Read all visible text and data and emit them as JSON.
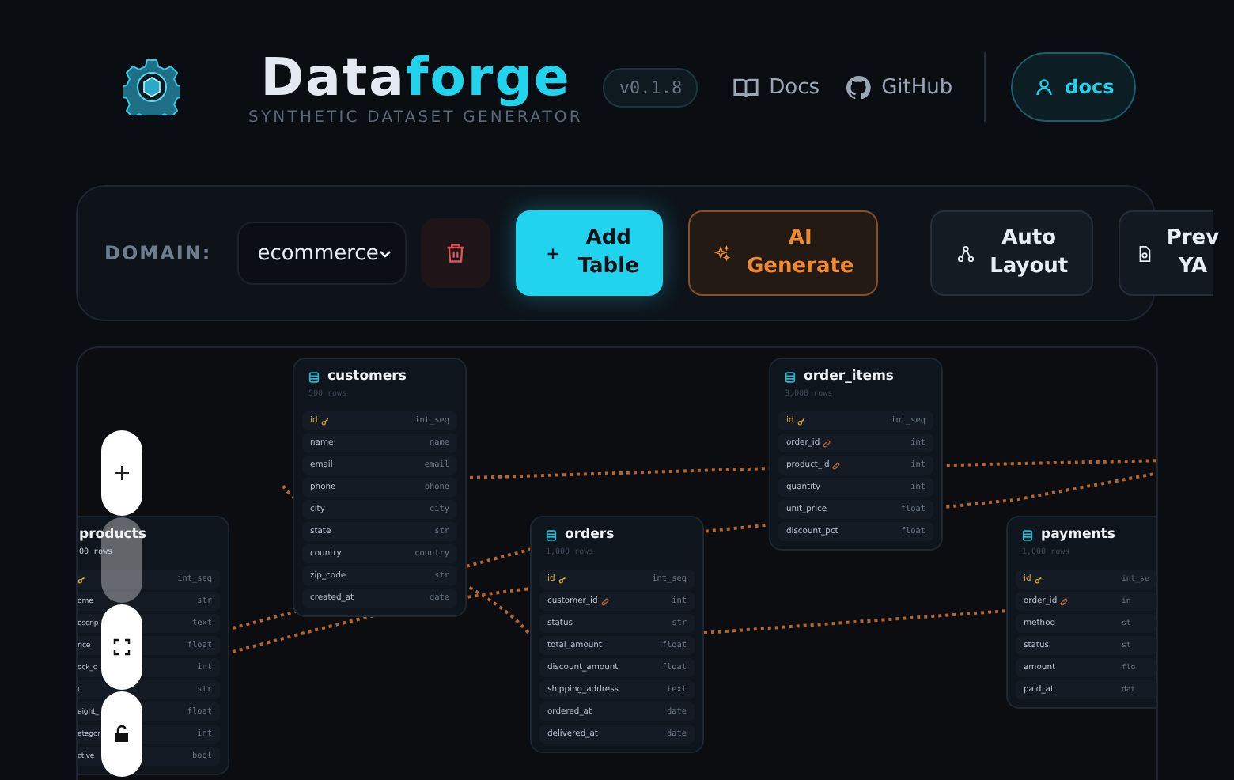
{
  "header": {
    "logo_text": [
      "Data",
      "forge"
    ],
    "subtitle": "SYNTHETIC DATASET GENERATOR",
    "version": "v0.1.8",
    "links": [
      {
        "kind": "book",
        "label": "Docs"
      },
      {
        "kind": "github",
        "label": "GitHub"
      }
    ],
    "user_button": {
      "label": "docs"
    }
  },
  "toolbar": {
    "domain_label": "DOMAIN:",
    "domain_value": "ecommerce",
    "buttons": [
      {
        "kind": "delete"
      },
      {
        "kind": "primary",
        "label": "Add Table"
      },
      {
        "kind": "accent",
        "label": "AI Generate"
      },
      {
        "kind": "secondary",
        "label": "Auto Layout"
      },
      {
        "kind": "cut",
        "label": "Prev YA"
      }
    ]
  },
  "canvas": {
    "tables": [
      {
        "kind": "cut-left",
        "name": "products",
        "rows_label": "00 rows",
        "fields": [
          {
            "kind": "pk",
            "type": "int_seq"
          },
          {
            "kind": "plain",
            "name": "ome",
            "type": "str"
          },
          {
            "kind": "plain",
            "name": "escrip",
            "type": "text"
          },
          {
            "kind": "plain",
            "name": "rice",
            "type": "float"
          },
          {
            "kind": "plain",
            "name": "ock_c",
            "type": "int"
          },
          {
            "kind": "plain",
            "name": "u",
            "type": "str"
          },
          {
            "kind": "plain",
            "name": "eight_",
            "type": "float"
          },
          {
            "kind": "plain",
            "name": "ategor",
            "type": "int"
          },
          {
            "kind": "plain",
            "name": "ctive",
            "type": "bool"
          }
        ]
      },
      {
        "kind": "full",
        "name": "customers",
        "rows_label": "500 rows",
        "fields": [
          {
            "kind": "pk",
            "name": "id",
            "type": "int_seq"
          },
          {
            "kind": "plain",
            "name": "name",
            "type": "name"
          },
          {
            "kind": "plain",
            "name": "email",
            "type": "email"
          },
          {
            "kind": "plain",
            "name": "phone",
            "type": "phone"
          },
          {
            "kind": "plain",
            "name": "city",
            "type": "city"
          },
          {
            "kind": "plain",
            "name": "state",
            "type": "str"
          },
          {
            "kind": "plain",
            "name": "country",
            "type": "country"
          },
          {
            "kind": "plain",
            "name": "zip_code",
            "type": "str"
          },
          {
            "kind": "plain",
            "name": "created_at",
            "type": "date"
          }
        ]
      },
      {
        "kind": "full",
        "name": "orders",
        "rows_label": "1,000 rows",
        "fields": [
          {
            "kind": "pk",
            "name": "id",
            "type": "int_seq"
          },
          {
            "kind": "fk",
            "name": "customer_id",
            "type": "int"
          },
          {
            "kind": "plain",
            "name": "status",
            "type": "str"
          },
          {
            "kind": "plain",
            "name": "total_amount",
            "type": "float"
          },
          {
            "kind": "plain",
            "name": "discount_amount",
            "type": "float"
          },
          {
            "kind": "plain",
            "name": "shipping_address",
            "type": "text"
          },
          {
            "kind": "plain",
            "name": "ordered_at",
            "type": "date"
          },
          {
            "kind": "plain",
            "name": "delivered_at",
            "type": "date"
          }
        ]
      },
      {
        "kind": "full",
        "name": "order_items",
        "rows_label": "3,000 rows",
        "fields": [
          {
            "kind": "pk",
            "name": "id",
            "type": "int_seq"
          },
          {
            "kind": "fk",
            "name": "order_id",
            "type": "int"
          },
          {
            "kind": "fk",
            "name": "product_id",
            "type": "int"
          },
          {
            "kind": "plain",
            "name": "quantity",
            "type": "int"
          },
          {
            "kind": "plain",
            "name": "unit_price",
            "type": "float"
          },
          {
            "kind": "plain",
            "name": "discount_pct",
            "type": "float"
          }
        ]
      },
      {
        "kind": "cut-right",
        "name": "payments",
        "rows_label": "1,000 rows",
        "fields": [
          {
            "kind": "pk",
            "name": "id",
            "type": "int_se"
          },
          {
            "kind": "fk",
            "name": "order_id",
            "type": "in"
          },
          {
            "kind": "plain",
            "name": "method",
            "type": "st"
          },
          {
            "kind": "plain",
            "name": "status",
            "type": "st"
          },
          {
            "kind": "plain",
            "name": "amount",
            "type": "flo"
          },
          {
            "kind": "plain",
            "name": "paid_at",
            "type": "dat"
          }
        ]
      }
    ],
    "controls": [
      {
        "kind": "zoom-in",
        "disabled": false
      },
      {
        "kind": "zoom-out",
        "disabled": true
      },
      {
        "kind": "fit",
        "disabled": false
      },
      {
        "kind": "lock",
        "disabled": false
      }
    ]
  }
}
